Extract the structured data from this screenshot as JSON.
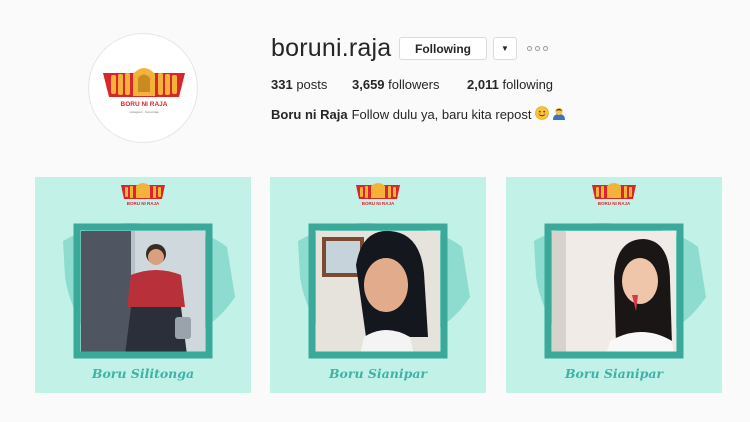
{
  "profile": {
    "username": "boruni.raja",
    "follow_label": "Following",
    "dropdown_icon": "chevron-down-icon",
    "more_icon": "more-options-icon",
    "stats": {
      "posts_count": "331",
      "posts_label": "posts",
      "followers_count": "3,659",
      "followers_label": "followers",
      "following_count": "2,011",
      "following_label": "following"
    },
    "bio": {
      "name": "Boru ni Raja",
      "text": "Follow dulu ya, baru kita repost"
    },
    "avatar_logo_text": "BORU NI RAJA",
    "avatar_logo_subtext": "instagram · boruniraja"
  },
  "posts": [
    {
      "logo_text": "BORU NI RAJA",
      "caption": "Boru Silitonga"
    },
    {
      "logo_text": "BORU NI RAJA",
      "caption": "Boru Sianipar"
    },
    {
      "logo_text": "BORU NI RAJA",
      "caption": "Boru Sianipar"
    }
  ],
  "colors": {
    "post_bg": "#c2f1e8",
    "frame": "#3aa99a",
    "caption": "#3fb2a5",
    "logo_red": "#d8262b",
    "logo_gold": "#f3b33a"
  }
}
